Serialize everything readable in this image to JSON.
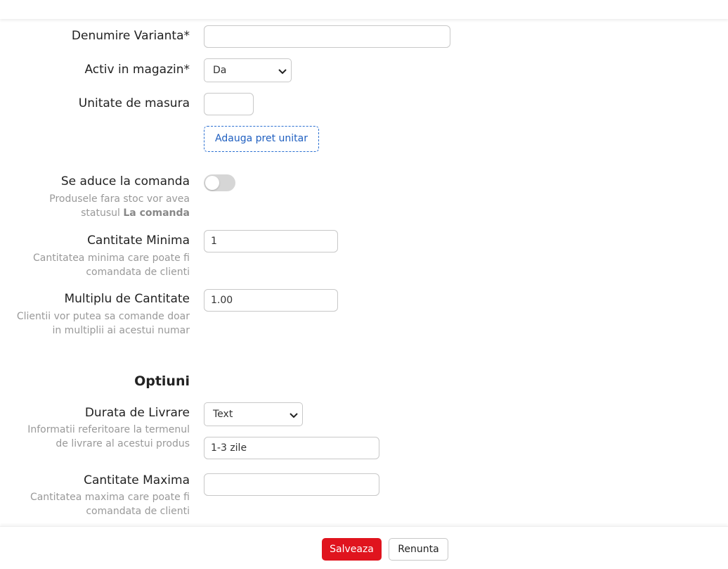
{
  "fields": {
    "variant_name": {
      "label": "Denumire Varianta*",
      "value": ""
    },
    "active_in_store": {
      "label": "Activ in magazin*",
      "selected": "Da"
    },
    "unit_of_measure": {
      "label": "Unitate de masura",
      "value": ""
    },
    "add_unit_price_label": "Adauga pret unitar",
    "brought_on_order": {
      "label": "Se aduce la comanda",
      "hint_line1": "Produsele fara stoc vor avea",
      "hint_line2_prefix": "statusul ",
      "hint_line2_bold": "La comanda",
      "enabled": false
    },
    "min_quantity": {
      "label": "Cantitate Minima",
      "hint_line1": "Cantitatea minima care poate fi",
      "hint_line2": "comandata de clienti",
      "value": "1"
    },
    "quantity_multiple": {
      "label": "Multiplu de Cantitate",
      "hint_line1": "Clientii vor putea sa comande doar",
      "hint_line2": "in multiplii ai acestui numar",
      "value": "1.00"
    }
  },
  "options": {
    "title": "Optiuni",
    "delivery_time": {
      "label": "Durata de Livrare",
      "hint_line1": "Informatii referitoare la termenul",
      "hint_line2": "de livrare al acestui produs",
      "type_selected": "Text",
      "value": "1-3 zile"
    },
    "max_quantity": {
      "label": "Cantitate Maxima",
      "hint_line1": "Cantitatea maxima care poate fi",
      "hint_line2": "comandata de clienti",
      "value": ""
    }
  },
  "footer": {
    "save_label": "Salveaza",
    "cancel_label": "Renunta"
  },
  "colors": {
    "primary_red": "#e0141e",
    "link_blue": "#1f5fc0",
    "hint_gray": "#999999"
  }
}
